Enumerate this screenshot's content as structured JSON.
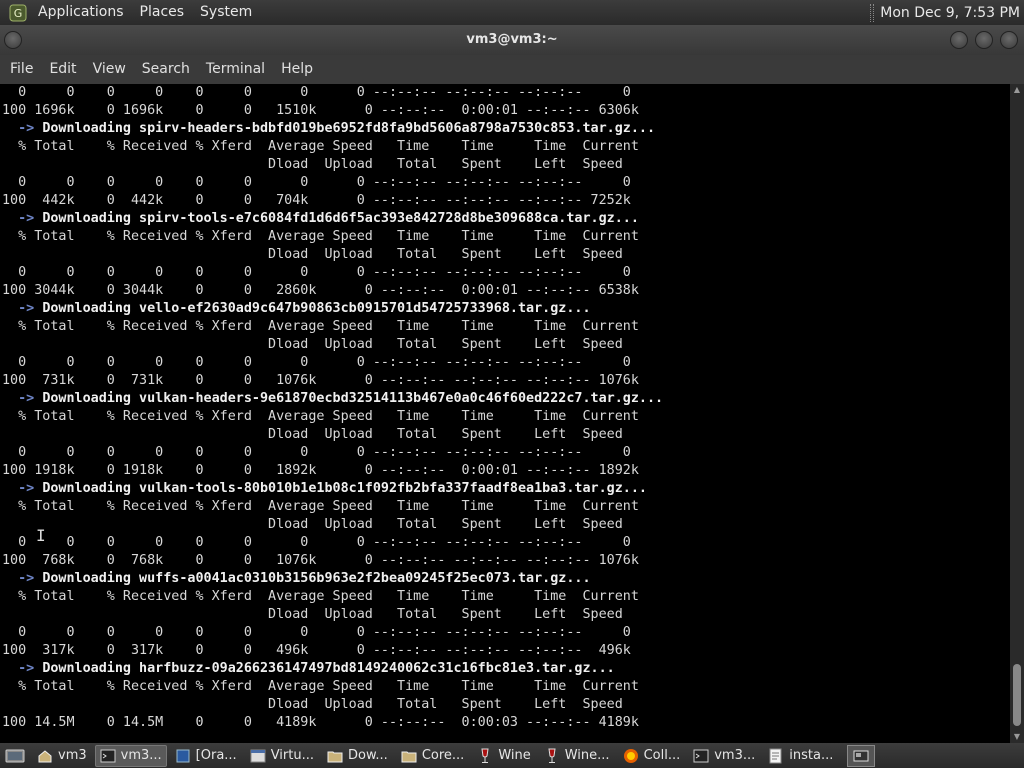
{
  "top_panel": {
    "menus": [
      "Applications",
      "Places",
      "System"
    ],
    "clock": "Mon Dec 9, 7:53 PM"
  },
  "window": {
    "title": "vm3@vm3:~"
  },
  "menubar": [
    "File",
    "Edit",
    "View",
    "Search",
    "Terminal",
    "Help"
  ],
  "terminal": {
    "lines": [
      {
        "type": "text",
        "text": "  0     0    0     0    0     0      0      0 --:--:-- --:--:-- --:--:--     0"
      },
      {
        "type": "text",
        "text": "100 1696k    0 1696k    0     0   1510k      0 --:--:--  0:00:01 --:--:-- 6306k"
      },
      {
        "type": "download",
        "text": "Downloading spirv-headers-bdbfd019be6952fd8fa9bd5606a8798a7530c853.tar.gz..."
      },
      {
        "type": "text",
        "text": "  % Total    % Received % Xferd  Average Speed   Time    Time     Time  Current"
      },
      {
        "type": "text",
        "text": "                                 Dload  Upload   Total   Spent    Left  Speed"
      },
      {
        "type": "text",
        "text": "  0     0    0     0    0     0      0      0 --:--:-- --:--:-- --:--:--     0"
      },
      {
        "type": "text",
        "text": "100  442k    0  442k    0     0   704k      0 --:--:-- --:--:-- --:--:-- 7252k"
      },
      {
        "type": "download",
        "text": "Downloading spirv-tools-e7c6084fd1d6d6f5ac393e842728d8be309688ca.tar.gz..."
      },
      {
        "type": "text",
        "text": "  % Total    % Received % Xferd  Average Speed   Time    Time     Time  Current"
      },
      {
        "type": "text",
        "text": "                                 Dload  Upload   Total   Spent    Left  Speed"
      },
      {
        "type": "text",
        "text": "  0     0    0     0    0     0      0      0 --:--:-- --:--:-- --:--:--     0"
      },
      {
        "type": "text",
        "text": "100 3044k    0 3044k    0     0   2860k      0 --:--:--  0:00:01 --:--:-- 6538k"
      },
      {
        "type": "download",
        "text": "Downloading vello-ef2630ad9c647b90863cb0915701d54725733968.tar.gz..."
      },
      {
        "type": "text",
        "text": "  % Total    % Received % Xferd  Average Speed   Time    Time     Time  Current"
      },
      {
        "type": "text",
        "text": "                                 Dload  Upload   Total   Spent    Left  Speed"
      },
      {
        "type": "text",
        "text": "  0     0    0     0    0     0      0      0 --:--:-- --:--:-- --:--:--     0"
      },
      {
        "type": "text",
        "text": "100  731k    0  731k    0     0   1076k      0 --:--:-- --:--:-- --:--:-- 1076k"
      },
      {
        "type": "download",
        "text": "Downloading vulkan-headers-9e61870ecbd32514113b467e0a0c46f60ed222c7.tar.gz..."
      },
      {
        "type": "text",
        "text": "  % Total    % Received % Xferd  Average Speed   Time    Time     Time  Current"
      },
      {
        "type": "text",
        "text": "                                 Dload  Upload   Total   Spent    Left  Speed"
      },
      {
        "type": "text",
        "text": "  0     0    0     0    0     0      0      0 --:--:-- --:--:-- --:--:--     0"
      },
      {
        "type": "text",
        "text": "100 1918k    0 1918k    0     0   1892k      0 --:--:--  0:00:01 --:--:-- 1892k"
      },
      {
        "type": "download",
        "text": "Downloading vulkan-tools-80b010b1e1b08c1f092fb2bfa337faadf8ea1ba3.tar.gz..."
      },
      {
        "type": "text",
        "text": "  % Total    % Received % Xferd  Average Speed   Time    Time     Time  Current"
      },
      {
        "type": "text",
        "text": "                                 Dload  Upload   Total   Spent    Left  Speed"
      },
      {
        "type": "text",
        "text": "  0     0    0     0    0     0      0      0 --:--:-- --:--:-- --:--:--     0"
      },
      {
        "type": "text",
        "text": "100  768k    0  768k    0     0   1076k      0 --:--:-- --:--:-- --:--:-- 1076k"
      },
      {
        "type": "download",
        "text": "Downloading wuffs-a0041ac0310b3156b963e2f2bea09245f25ec073.tar.gz..."
      },
      {
        "type": "text",
        "text": "  % Total    % Received % Xferd  Average Speed   Time    Time     Time  Current"
      },
      {
        "type": "text",
        "text": "                                 Dload  Upload   Total   Spent    Left  Speed"
      },
      {
        "type": "text",
        "text": "  0     0    0     0    0     0      0      0 --:--:-- --:--:-- --:--:--     0"
      },
      {
        "type": "text",
        "text": "100  317k    0  317k    0     0   496k      0 --:--:-- --:--:-- --:--:--  496k"
      },
      {
        "type": "download",
        "text": "Downloading harfbuzz-09a266236147497bd8149240062c31c16fbc81e3.tar.gz..."
      },
      {
        "type": "text",
        "text": "  % Total    % Received % Xferd  Average Speed   Time    Time     Time  Current"
      },
      {
        "type": "text",
        "text": "                                 Dload  Upload   Total   Spent    Left  Speed"
      },
      {
        "type": "text",
        "text": "100 14.5M    0 14.5M    0     0   4189k      0 --:--:--  0:00:03 --:--:-- 4189k"
      }
    ]
  },
  "taskbar": {
    "tasks": [
      {
        "label": "vm3",
        "icon": "home-folder-icon",
        "active": false
      },
      {
        "label": "vm3...",
        "icon": "terminal-icon",
        "active": true
      },
      {
        "label": "[Ora...",
        "icon": "virtualbox-icon",
        "active": false
      },
      {
        "label": "Virtu...",
        "icon": "window-icon",
        "active": false
      },
      {
        "label": "Dow...",
        "icon": "folder-icon",
        "active": false
      },
      {
        "label": "Core...",
        "icon": "folder-icon",
        "active": false
      },
      {
        "label": "Wine",
        "icon": "wine-icon",
        "active": false
      },
      {
        "label": "Wine...",
        "icon": "wine-icon",
        "active": false
      },
      {
        "label": "Coll...",
        "icon": "firefox-icon",
        "active": false
      },
      {
        "label": "vm3...",
        "icon": "terminal-icon",
        "active": false
      },
      {
        "label": "insta...",
        "icon": "text-editor-icon",
        "active": false
      }
    ]
  },
  "colors": {
    "download_arrow": "#6f86c8",
    "terminal_bg": "#000000",
    "terminal_fg": "#d8d8d8"
  }
}
